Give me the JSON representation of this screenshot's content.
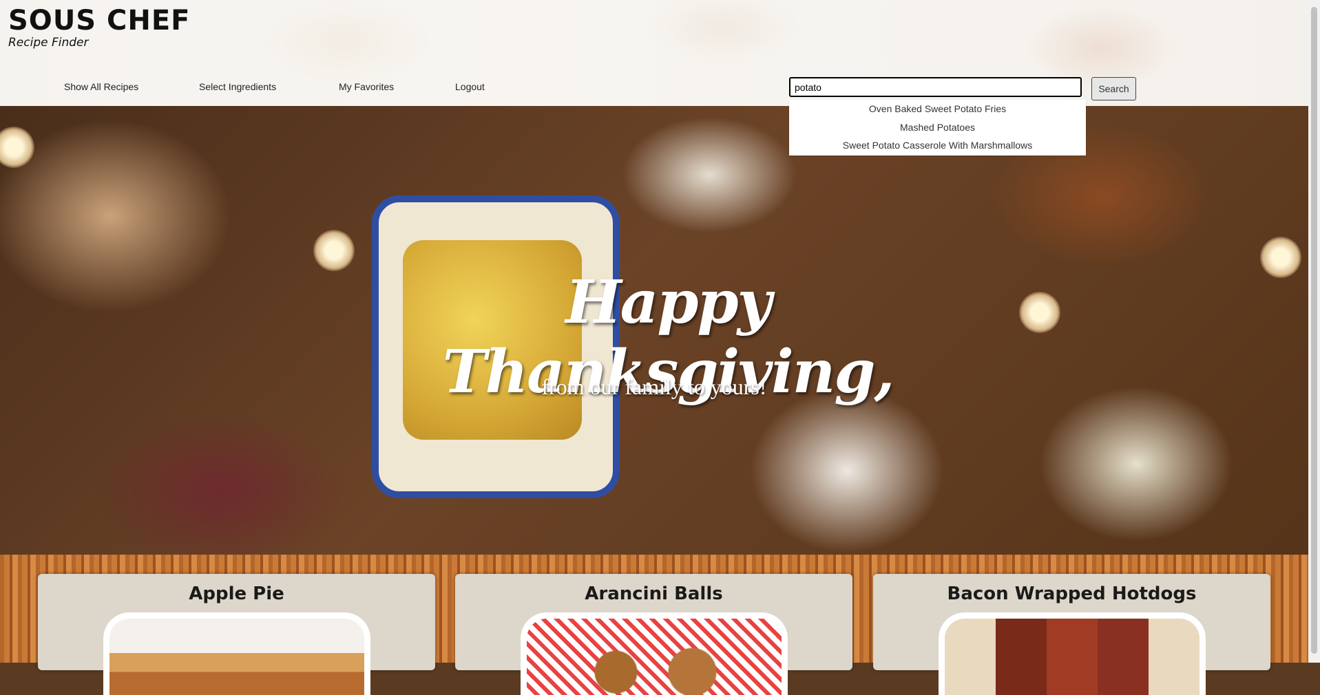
{
  "brand": {
    "title": "SOUS CHEF",
    "subtitle": "Recipe Finder"
  },
  "nav": {
    "items": [
      {
        "label": "Show All Recipes"
      },
      {
        "label": "Select Ingredients"
      },
      {
        "label": "My Favorites"
      },
      {
        "label": "Logout"
      }
    ]
  },
  "search": {
    "value": "potato",
    "button_label": "Search",
    "suggestions": [
      "Oven Baked Sweet Potato Fries",
      "Mashed Potatoes",
      "Sweet Potato Casserole With Marshmallows"
    ]
  },
  "hero": {
    "title": "Happy Thanksgiving,",
    "subtitle": "from our family to yours!"
  },
  "cards": [
    {
      "title": "Apple Pie"
    },
    {
      "title": "Arancini Balls"
    },
    {
      "title": "Bacon Wrapped Hotdogs"
    }
  ]
}
